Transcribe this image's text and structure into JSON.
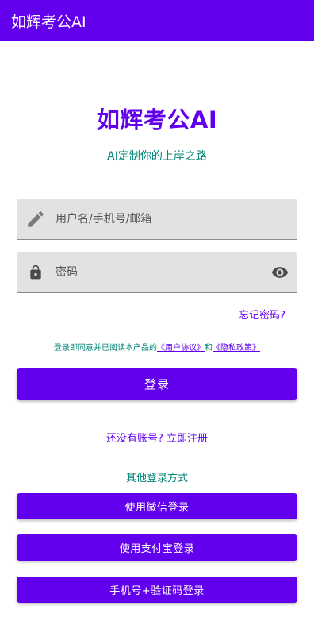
{
  "appbar": {
    "title": "如辉考公AI"
  },
  "header": {
    "title": "如辉考公AI",
    "subtitle": "AI定制你的上岸之路"
  },
  "form": {
    "username": {
      "placeholder": "用户名/手机号/邮箱",
      "value": "",
      "icon": "pencil-icon"
    },
    "password": {
      "placeholder": "密码",
      "value": "",
      "icon": "lock-icon",
      "toggle_icon": "eye-icon"
    },
    "forgot_label": "忘记密码?"
  },
  "agreement": {
    "prefix": "登录即同意并已阅读本产品的",
    "user_agreement": "《用户协议》",
    "and": "和",
    "privacy_policy": "《隐私政策》"
  },
  "buttons": {
    "login": "登录",
    "wechat": "使用微信登录",
    "alipay": "使用支付宝登录",
    "sms": "手机号+验证码登录"
  },
  "register_label": "还没有账号? 立即注册",
  "other_methods_label": "其他登录方式",
  "colors": {
    "primary": "#6200ee",
    "accent_text": "#008577",
    "field_bg": "#e2e2e2"
  }
}
